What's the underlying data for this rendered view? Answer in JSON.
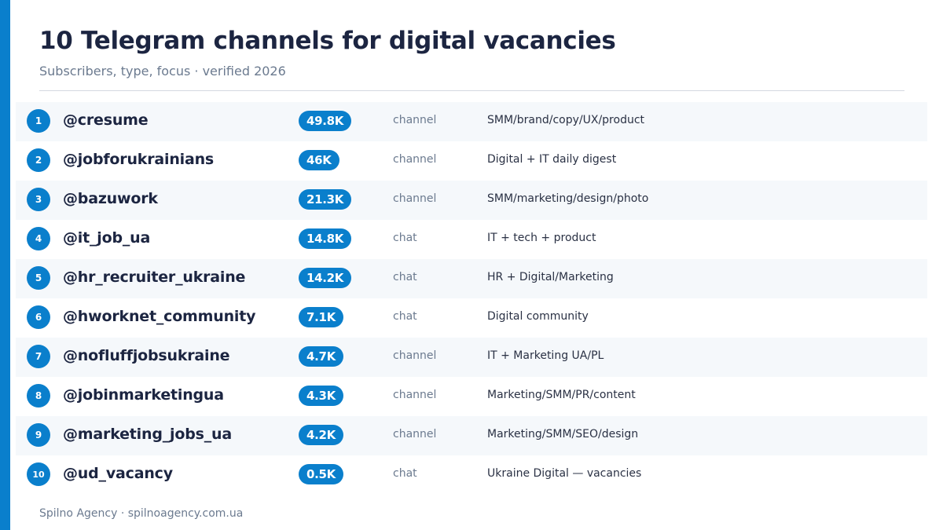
{
  "header": {
    "title": "10 Telegram channels for digital vacancies",
    "subtitle": "Subscribers, type, focus · verified 2026"
  },
  "colors": {
    "accent": "#0a7fcc",
    "title": "#1c2541",
    "muted": "#6b7a8f",
    "row_alt_bg": "#f5f8fb"
  },
  "rows": [
    {
      "rank": "1",
      "handle": "@cresume",
      "subscribers": "49.8K",
      "type": "channel",
      "focus": "SMM/brand/copy/UX/product"
    },
    {
      "rank": "2",
      "handle": "@jobforukrainians",
      "subscribers": "46K",
      "type": "channel",
      "focus": "Digital + IT daily digest"
    },
    {
      "rank": "3",
      "handle": "@bazuwork",
      "subscribers": "21.3K",
      "type": "channel",
      "focus": "SMM/marketing/design/photo"
    },
    {
      "rank": "4",
      "handle": "@it_job_ua",
      "subscribers": "14.8K",
      "type": "chat",
      "focus": "IT + tech + product"
    },
    {
      "rank": "5",
      "handle": "@hr_recruiter_ukraine",
      "subscribers": "14.2K",
      "type": "chat",
      "focus": "HR + Digital/Marketing"
    },
    {
      "rank": "6",
      "handle": "@hworknet_community",
      "subscribers": "7.1K",
      "type": "chat",
      "focus": "Digital community"
    },
    {
      "rank": "7",
      "handle": "@nofluffjobsukraine",
      "subscribers": "4.7K",
      "type": "channel",
      "focus": "IT + Marketing UA/PL"
    },
    {
      "rank": "8",
      "handle": "@jobinmarketingua",
      "subscribers": "4.3K",
      "type": "channel",
      "focus": "Marketing/SMM/PR/content"
    },
    {
      "rank": "9",
      "handle": "@marketing_jobs_ua",
      "subscribers": "4.2K",
      "type": "channel",
      "focus": "Marketing/SMM/SEO/design"
    },
    {
      "rank": "10",
      "handle": "@ud_vacancy",
      "subscribers": "0.5K",
      "type": "chat",
      "focus": "Ukraine Digital — vacancies"
    }
  ],
  "footer": {
    "text": "Spilno Agency · spilnoagency.com.ua"
  }
}
